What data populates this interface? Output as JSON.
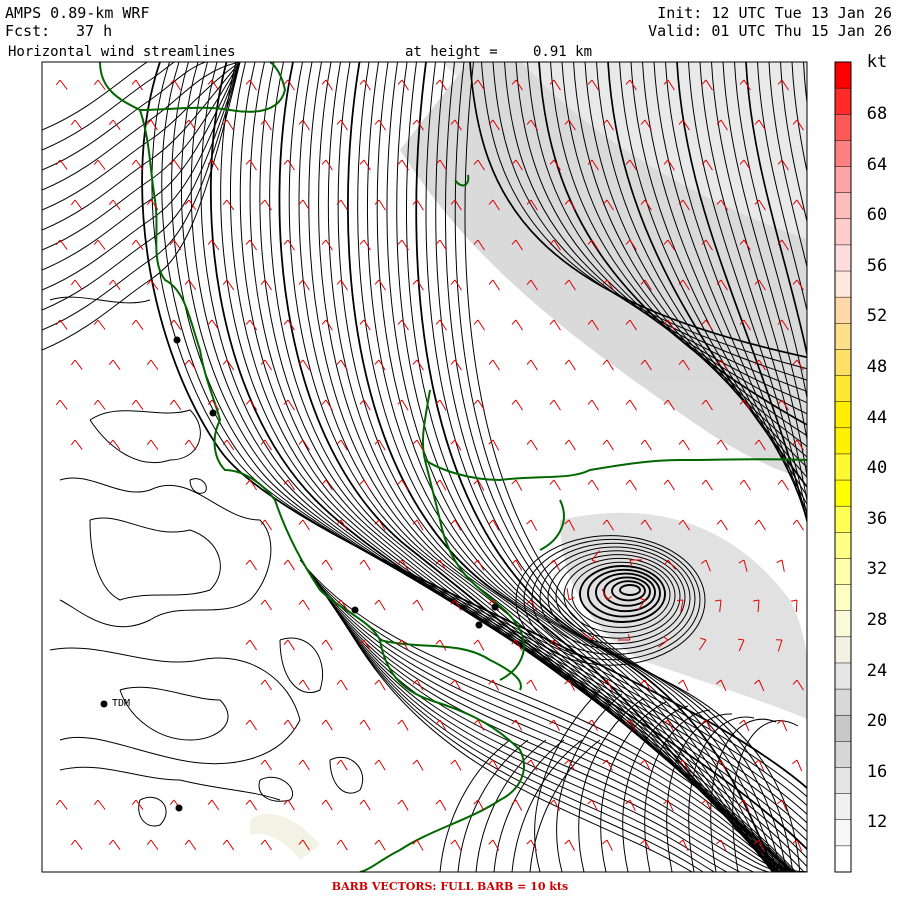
{
  "header": {
    "model": "AMPS 0.89-km WRF",
    "forecast_label": "Fcst:",
    "forecast_value": "37 h",
    "field": "Horizontal wind streamlines",
    "height_label": "at height =",
    "height_value": "0.91 km",
    "init": "Init: 12 UTC Tue 13 Jan 26",
    "valid": "Valid: 01 UTC Thu 15 Jan 26"
  },
  "colorbar": {
    "unit": "kt",
    "tick_labels": [
      "68",
      "64",
      "60",
      "56",
      "52",
      "48",
      "44",
      "40",
      "36",
      "32",
      "28",
      "24",
      "20",
      "16",
      "12"
    ],
    "colors": [
      "#ff0000",
      "#ff2a2a",
      "#ff5a5a",
      "#ff8080",
      "#ffa5a5",
      "#ffbcbc",
      "#ffcccc",
      "#ffdddd",
      "#ffe8dd",
      "#ffd8a8",
      "#ffe08a",
      "#ffe066",
      "#ffe833",
      "#ffee00",
      "#fff200",
      "#fff833",
      "#ffff00",
      "#ffff55",
      "#ffff88",
      "#ffffaa",
      "#ffffc4",
      "#fafada",
      "#f2f2e2",
      "#e6e6e6",
      "#d8d8d8",
      "#c8c8c8",
      "#d6d6d6",
      "#e4e4e4",
      "#f0f0f0",
      "#f8f8f8",
      "#ffffff"
    ]
  },
  "sites": [
    {
      "name": "TDM"
    }
  ],
  "legend": {
    "barb_note": "BARB VECTORS:  FULL BARB = 10 kts"
  },
  "styles": {
    "streamline_color": "#000000",
    "coast_color": "#006600",
    "barb_color": "#dd0000",
    "shade_color": "#c0c0c0"
  }
}
